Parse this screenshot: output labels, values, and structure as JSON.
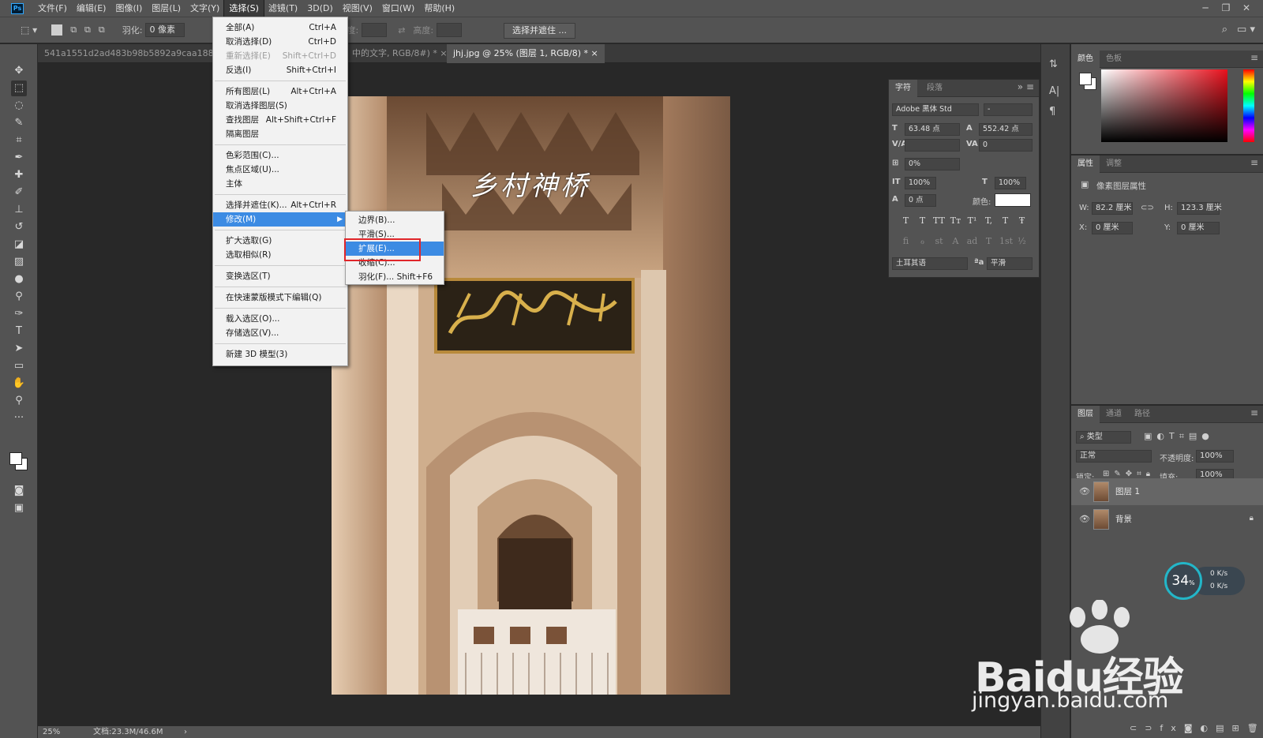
{
  "menubar": {
    "logo": "Ps",
    "items": [
      "文件(F)",
      "编辑(E)",
      "图像(I)",
      "图层(L)",
      "文字(Y)",
      "选择(S)",
      "滤镜(T)",
      "3D(D)",
      "视图(V)",
      "窗口(W)",
      "帮助(H)"
    ],
    "active_index": 5
  },
  "options": {
    "feather_label": "羽化:",
    "feather_value": "0 像素",
    "width_label": "宽度:",
    "height_label": "高度:",
    "select_mask_button": "选择并遮住 ..."
  },
  "tabs": [
    {
      "label": "541a1551d2ad483b98b5892a9caa1882.psd @"
    },
    {
      "label": "中的文字, RGB/8#) *  ×"
    },
    {
      "label": "jhj.jpg @ 25% (图层 1, RGB/8) *  ×"
    }
  ],
  "select_menu": {
    "items": [
      {
        "label": "全部(A)",
        "shortcut": "Ctrl+A"
      },
      {
        "label": "取消选择(D)",
        "shortcut": "Ctrl+D"
      },
      {
        "label": "重新选择(E)",
        "shortcut": "Shift+Ctrl+D",
        "disabled": true
      },
      {
        "label": "反选(I)",
        "shortcut": "Shift+Ctrl+I"
      },
      {
        "label": "所有图层(L)",
        "shortcut": "Alt+Ctrl+A"
      },
      {
        "label": "取消选择图层(S)",
        "shortcut": ""
      },
      {
        "label": "查找图层",
        "shortcut": "Alt+Shift+Ctrl+F"
      },
      {
        "label": "隔离图层",
        "shortcut": ""
      },
      {
        "label": "色彩范围(C)...",
        "shortcut": ""
      },
      {
        "label": "焦点区域(U)...",
        "shortcut": ""
      },
      {
        "label": "主体",
        "shortcut": ""
      },
      {
        "label": "选择并遮住(K)...",
        "shortcut": "Alt+Ctrl+R"
      },
      {
        "label": "修改(M)",
        "shortcut": ""
      },
      {
        "label": "扩大选取(G)",
        "shortcut": ""
      },
      {
        "label": "选取相似(R)",
        "shortcut": ""
      },
      {
        "label": "变换选区(T)",
        "shortcut": ""
      },
      {
        "label": "在快速蒙版模式下编辑(Q)",
        "shortcut": ""
      },
      {
        "label": "载入选区(O)...",
        "shortcut": ""
      },
      {
        "label": "存储选区(V)...",
        "shortcut": ""
      },
      {
        "label": "新建 3D 模型(3)",
        "shortcut": ""
      }
    ]
  },
  "modify_submenu": {
    "items": [
      {
        "label": "边界(B)...",
        "shortcut": ""
      },
      {
        "label": "平滑(S)...",
        "shortcut": ""
      },
      {
        "label": "扩展(E)...",
        "shortcut": ""
      },
      {
        "label": "收缩(C)...",
        "shortcut": ""
      },
      {
        "label": "羽化(F)...",
        "shortcut": "Shift+F6"
      }
    ],
    "highlighted_index": 2
  },
  "canvas": {
    "overlay_text": "乡村神桥"
  },
  "character_panel": {
    "tabs": [
      "字符",
      "段落"
    ],
    "font_family": "Adobe 黑体 Std",
    "font_style": "-",
    "font_size": "63.48 点",
    "leading": "552.42 点",
    "kerning": "",
    "tracking": "0",
    "scale_pct": "0%",
    "vertical_scale": "100%",
    "horizontal_scale": "100%",
    "baseline": "0 点",
    "color_label": "颜色:",
    "language": "土耳其语",
    "antialias": "平滑",
    "format_buttons": [
      "T",
      "T",
      "TT",
      "Tт",
      "T¹",
      "T,",
      "T",
      "Ŧ"
    ],
    "opentype_buttons": [
      "fi",
      "ℴ",
      "st",
      "A",
      "ad",
      "T",
      "1st",
      "½"
    ]
  },
  "color_panel": {
    "tabs": [
      "颜色",
      "色板"
    ]
  },
  "properties_panel": {
    "tabs": [
      "属性",
      "调整"
    ],
    "title": "像素图层属性",
    "w_label": "W:",
    "w_value": "82.2 厘米",
    "h_label": "H:",
    "h_value": "123.3 厘米",
    "x_label": "X:",
    "x_value": "0 厘米",
    "y_label": "Y:",
    "y_value": "0 厘米"
  },
  "layers_panel": {
    "tabs": [
      "图层",
      "通道",
      "路径"
    ],
    "filter_kind": "类型",
    "blend_mode": "正常",
    "opacity_label": "不透明度:",
    "opacity_value": "100%",
    "lock_label": "锁定:",
    "fill_label": "填充:",
    "fill_value": "100%",
    "layers": [
      {
        "name": "图层 1",
        "selected": true
      },
      {
        "name": "背景",
        "selected": false,
        "locked": true
      }
    ]
  },
  "status": {
    "zoom": "25%",
    "doc": "文档:23.3M/46.6M"
  },
  "network": {
    "percent": "34",
    "unit": "%",
    "up": "0 K/s",
    "down": "0 K/s"
  },
  "watermark": {
    "brand": "Baidu经验",
    "url": "jingyan.baidu.com"
  }
}
